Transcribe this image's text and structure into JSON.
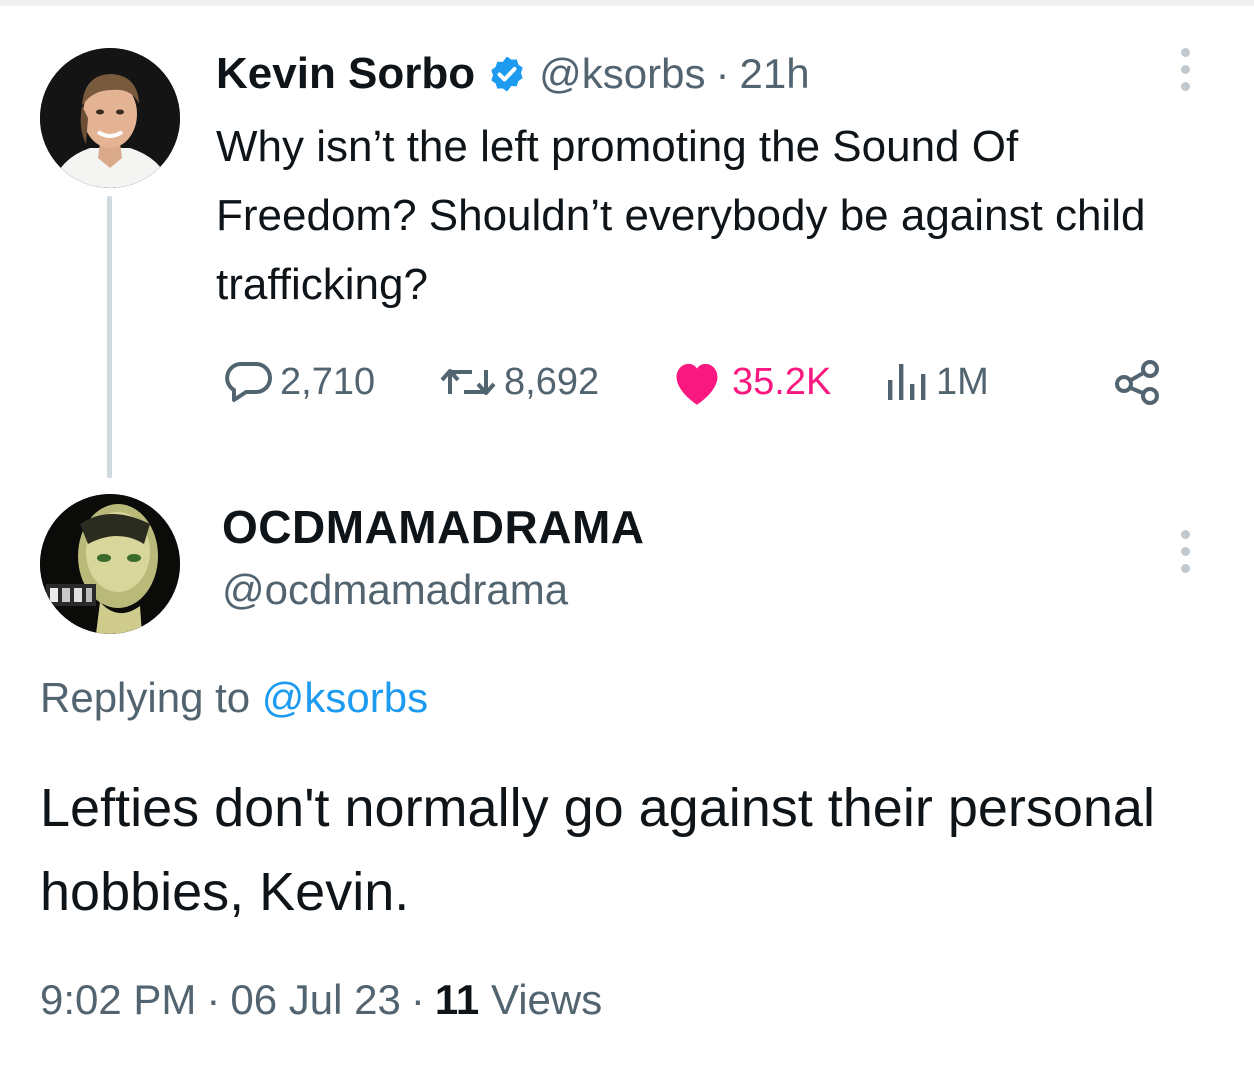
{
  "parent_tweet": {
    "author_name": "Kevin Sorbo",
    "handle": "@ksorbs",
    "separator": "·",
    "time": "21h",
    "text": "Why isn’t the left promoting the Sound Of Freedom? Shouldn’t everybody be against child trafficking?",
    "stats": {
      "replies": "2,710",
      "retweets": "8,692",
      "likes": "35.2K",
      "views": "1M"
    },
    "like_color": "#f91880",
    "verified_color": "#1d9bf0"
  },
  "reply_tweet": {
    "author_name": "OCDMAMADRAMA",
    "handle": "@ocdmamadrama",
    "replying_prefix": "Replying to",
    "replying_mention": "@ksorbs",
    "text": "Lefties don't normally go against their personal hobbies, Kevin.",
    "time": "9:02 PM",
    "date": "06 Jul 23",
    "separator": "·",
    "views_count": "11",
    "views_label": "Views",
    "link_color": "#1d9bf0"
  },
  "icons": {
    "reply": "speech-bubble-icon",
    "retweet": "retweet-arrows-icon",
    "like": "heart-icon",
    "views": "bar-chart-icon",
    "share": "share-nodes-icon",
    "more": "vertical-ellipsis-icon",
    "verified": "verified-badge-icon"
  }
}
